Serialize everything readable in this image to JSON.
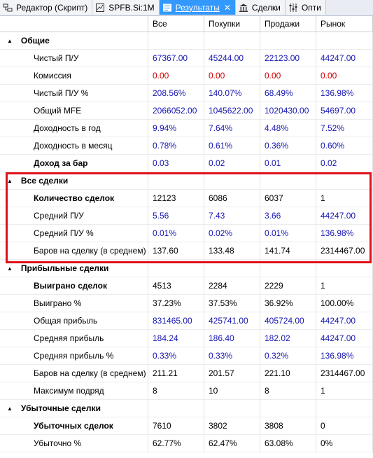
{
  "tabs": [
    {
      "label": "Редактор (Скрипт)",
      "icon": "script-editor-icon",
      "active": false
    },
    {
      "label": "SPFB.Si:1M",
      "icon": "chart-icon",
      "active": false
    },
    {
      "label": "Результаты",
      "icon": "results-icon",
      "active": true,
      "close": "✕"
    },
    {
      "label": "Сделки",
      "icon": "bank-icon",
      "active": false
    },
    {
      "label": "Опти",
      "icon": "optimization-icon",
      "active": false
    }
  ],
  "columns": [
    "",
    "Все",
    "Покупки",
    "Продажи",
    "Рынок"
  ],
  "colors": {
    "blue": "#1717b3",
    "red": "#d00000",
    "highlight_box": "#e0101a",
    "active_tab": "#3399ff"
  },
  "sections": [
    {
      "title": "Общие",
      "rows": [
        {
          "label": "Чистый П/У",
          "bold": false,
          "color": "blue",
          "values": [
            "67367.00",
            "45244.00",
            "22123.00",
            "44247.00"
          ]
        },
        {
          "label": "Комиссия",
          "bold": false,
          "color": "red",
          "values": [
            "0.00",
            "0.00",
            "0.00",
            "0.00"
          ]
        },
        {
          "label": "Чистый П/У %",
          "bold": false,
          "color": "blue",
          "values": [
            "208.56%",
            "140.07%",
            "68.49%",
            "136.98%"
          ]
        },
        {
          "label": "Общий MFE",
          "bold": false,
          "color": "blue",
          "values": [
            "2066052.00",
            "1045622.00",
            "1020430.00",
            "54697.00"
          ]
        },
        {
          "label": "Доходность в год",
          "bold": false,
          "color": "blue",
          "values": [
            "9.94%",
            "7.64%",
            "4.48%",
            "7.52%"
          ]
        },
        {
          "label": "Доходность в месяц",
          "bold": false,
          "color": "blue",
          "values": [
            "0.78%",
            "0.61%",
            "0.36%",
            "0.60%"
          ]
        },
        {
          "label": "Доход за бар",
          "bold": true,
          "color": "blue",
          "values": [
            "0.03",
            "0.02",
            "0.01",
            "0.02"
          ]
        }
      ]
    },
    {
      "title": "Все сделки",
      "rows": [
        {
          "label": "Количество сделок",
          "bold": true,
          "color": "black",
          "values": [
            "12123",
            "6086",
            "6037",
            "1"
          ]
        },
        {
          "label": "Средний П/У",
          "bold": false,
          "color": "blue",
          "values": [
            "5.56",
            "7.43",
            "3.66",
            "44247.00"
          ]
        },
        {
          "label": "Средний П/У %",
          "bold": false,
          "color": "blue",
          "values": [
            "0.01%",
            "0.02%",
            "0.01%",
            "136.98%"
          ]
        },
        {
          "label": "Баров на сделку (в среднем)",
          "bold": false,
          "color": "black",
          "values": [
            "137.60",
            "133.48",
            "141.74",
            "2314467.00"
          ]
        }
      ]
    },
    {
      "title": "Прибыльные сделки",
      "rows": [
        {
          "label": "Выиграно сделок",
          "bold": true,
          "color": "black",
          "values": [
            "4513",
            "2284",
            "2229",
            "1"
          ]
        },
        {
          "label": "Выиграно %",
          "bold": false,
          "color": "black",
          "values": [
            "37.23%",
            "37.53%",
            "36.92%",
            "100.00%"
          ]
        },
        {
          "label": "Общая прибыль",
          "bold": false,
          "color": "blue",
          "values": [
            "831465.00",
            "425741.00",
            "405724.00",
            "44247.00"
          ]
        },
        {
          "label": "Средняя прибыль",
          "bold": false,
          "color": "blue",
          "values": [
            "184.24",
            "186.40",
            "182.02",
            "44247.00"
          ]
        },
        {
          "label": "Средняя прибыль %",
          "bold": false,
          "color": "blue",
          "values": [
            "0.33%",
            "0.33%",
            "0.32%",
            "136.98%"
          ]
        },
        {
          "label": "Баров на сделку (в среднем)",
          "bold": false,
          "color": "black",
          "values": [
            "211.21",
            "201.57",
            "221.10",
            "2314467.00"
          ]
        },
        {
          "label": "Максимум подряд",
          "bold": false,
          "color": "black",
          "values": [
            "8",
            "10",
            "8",
            "1"
          ]
        }
      ]
    },
    {
      "title": "Убыточные сделки",
      "rows": [
        {
          "label": "Убыточных сделок",
          "bold": true,
          "color": "black",
          "values": [
            "7610",
            "3802",
            "3808",
            "0"
          ]
        },
        {
          "label": "Убыточно %",
          "bold": false,
          "color": "black",
          "values": [
            "62.77%",
            "62.47%",
            "63.08%",
            "0%"
          ]
        }
      ]
    }
  ]
}
